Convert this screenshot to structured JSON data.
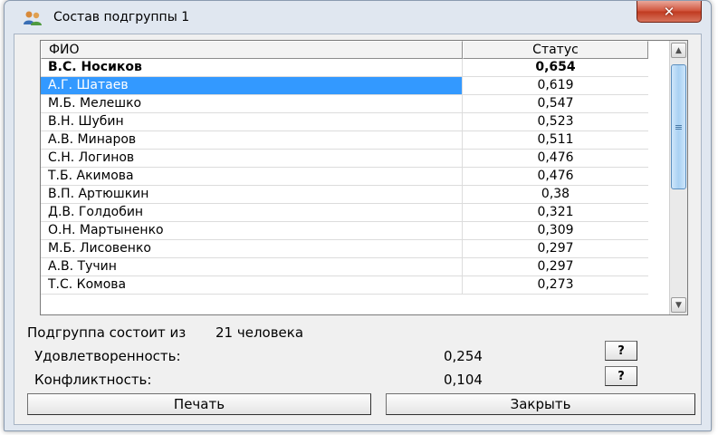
{
  "window": {
    "title": "Состав подгруппы 1",
    "close_symbol": "✕"
  },
  "table": {
    "columns": [
      "ФИО",
      "Статус"
    ],
    "rows": [
      [
        "В.С. Носиков",
        "0,654"
      ],
      [
        "А.Г. Шатаев",
        "0,619"
      ],
      [
        "М.Б. Мелешко",
        "0,547"
      ],
      [
        "В.Н. Шубин",
        "0,523"
      ],
      [
        "А.В. Минаров",
        "0,511"
      ],
      [
        "С.Н. Логинов",
        "0,476"
      ],
      [
        "Т.Б. Акимова",
        "0,476"
      ],
      [
        "В.П. Артюшкин",
        "0,38"
      ],
      [
        "Д.В. Голдобин",
        "0,321"
      ],
      [
        "О.Н. Мартыненко",
        "0,309"
      ],
      [
        "М.Б. Лисовенко",
        "0,297"
      ],
      [
        "А.В. Тучин",
        "0,297"
      ],
      [
        "Т.С. Комова",
        "0,273"
      ]
    ]
  },
  "summary": {
    "size_label": "Подгруппа состоит из",
    "size_value": "21 человека",
    "satisfaction_label": "Удовлетворенность:",
    "satisfaction_value": "0,254",
    "conflict_label": "Конфликтность:",
    "conflict_value": "0,104",
    "help_label": "?"
  },
  "buttons": {
    "print": "Печать",
    "close": "Закрыть"
  },
  "colors": {
    "selection": "#3399ff",
    "close_button": "#c9432c"
  },
  "icons": {
    "title": "users-icon",
    "scroll_up": "arrow-up-icon",
    "scroll_down": "arrow-down-icon",
    "thumb_grip": "grip-icon"
  }
}
